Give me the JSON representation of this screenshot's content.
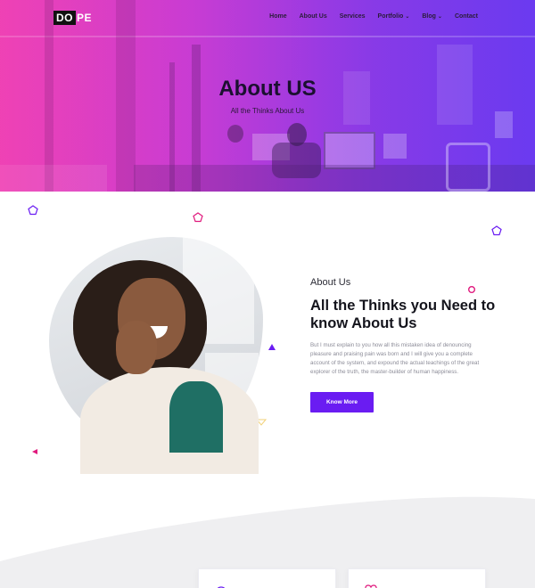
{
  "brand": {
    "logo_box": "DO",
    "logo_rest": "PE"
  },
  "nav": [
    {
      "label": "Home",
      "caret": ""
    },
    {
      "label": "About Us",
      "caret": ""
    },
    {
      "label": "Services",
      "caret": ""
    },
    {
      "label": "Portfolio",
      "caret": "⌄"
    },
    {
      "label": "Blog",
      "caret": "⌄"
    },
    {
      "label": "Contact",
      "caret": ""
    }
  ],
  "hero": {
    "title": "About US",
    "subtitle": "All the Thinks About Us"
  },
  "about": {
    "label": "About Us",
    "heading": "All the Thinks you Need to know About Us",
    "body": "But I must explain to you how all this mistaken idea of denouncing pleasure and praising pain was born and I will give you a complete account of the system, and expound the actual teachings of the great explorer of the truth, the master-builder of human happiness.",
    "button": "Know More"
  },
  "cards": [
    {
      "icon": "target-icon"
    },
    {
      "icon": "heart-icon"
    }
  ],
  "colors": {
    "hero_start": "#ee3fb5",
    "hero_end": "#6d3af0",
    "button": "#6a1cf2",
    "accent_pink": "#e0197d",
    "accent_purple": "#6a1cf2"
  }
}
